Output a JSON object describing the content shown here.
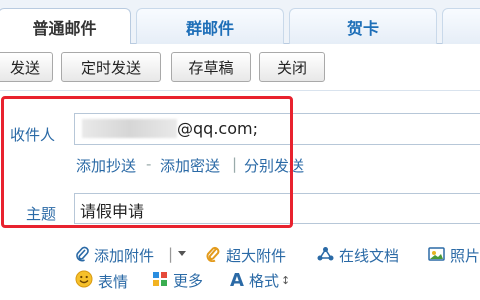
{
  "tabs": {
    "regular": "普通邮件",
    "group": "群邮件",
    "card": "贺卡"
  },
  "toolbar": {
    "send": "发送",
    "scheduled_send": "定时发送",
    "save_draft": "存草稿",
    "close": "关闭"
  },
  "recipient": {
    "label": "收件人",
    "value_visible": "@qq.com;"
  },
  "recipient_links": {
    "add_cc": "添加抄送",
    "sep1": "-",
    "add_bcc": "添加密送",
    "sep2": "|",
    "send_separately": "分别发送"
  },
  "subject": {
    "label": "主题",
    "value": "请假申请"
  },
  "attachments": {
    "add_attachment": "添加附件",
    "large_attachment": "超大附件",
    "online_docs": "在线文档",
    "photos": "照片"
  },
  "format_tools": {
    "emoji": "表情",
    "more": "更多",
    "format": "格式"
  },
  "colors": {
    "accent": "#2b6aa6",
    "highlight": "#e8222e"
  }
}
